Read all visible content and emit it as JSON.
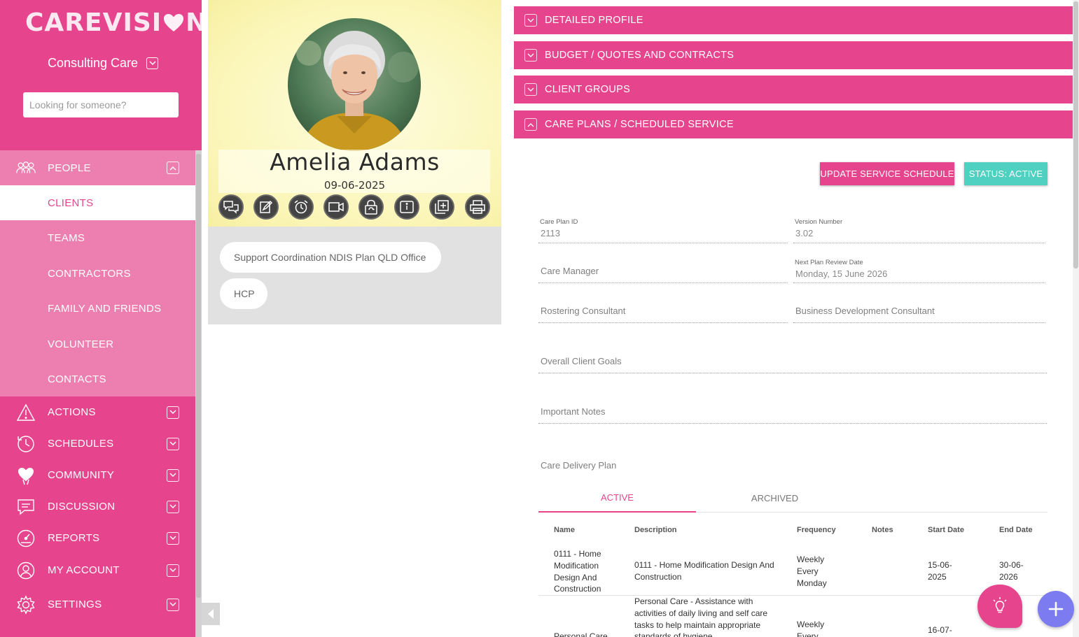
{
  "brand": {
    "logo_part1": "CAREVISI",
    "logo_part2": "N",
    "accent": "#e6458e",
    "teal": "#4fd0c0"
  },
  "sidebar": {
    "org_name": "Consulting Care",
    "search_placeholder": "Looking for someone?",
    "people": {
      "label": "PEOPLE",
      "items": [
        {
          "label": "CLIENTS",
          "active": true
        },
        {
          "label": "TEAMS"
        },
        {
          "label": "CONTRACTORS"
        },
        {
          "label": "FAMILY AND FRIENDS"
        },
        {
          "label": "VOLUNTEER"
        },
        {
          "label": "CONTACTS"
        }
      ]
    },
    "nav": [
      {
        "label": "ACTIONS",
        "icon": "warning-icon"
      },
      {
        "label": "SCHEDULES",
        "icon": "clock-cycle-icon"
      },
      {
        "label": "COMMUNITY",
        "icon": "heart-hands-icon"
      },
      {
        "label": "DISCUSSION",
        "icon": "chat-icon"
      },
      {
        "label": "REPORTS",
        "icon": "gauge-icon"
      },
      {
        "label": "MY ACCOUNT",
        "icon": "user-icon"
      },
      {
        "label": "SETTINGS",
        "icon": "gear-icon"
      }
    ]
  },
  "client": {
    "name": "Amelia Adams",
    "date": "09-06-2025",
    "actions": [
      "chat-icon",
      "edit-note-icon",
      "alarm-icon",
      "video-icon",
      "lock-refresh-icon",
      "info-icon",
      "add-document-icon",
      "print-icon"
    ],
    "tags": [
      "Support Coordination NDIS Plan QLD Office",
      "HCP"
    ]
  },
  "accordions": [
    {
      "label": "DETAILED PROFILE",
      "expanded": false
    },
    {
      "label": "BUDGET / QUOTES AND CONTRACTS",
      "expanded": false
    },
    {
      "label": "CLIENT GROUPS",
      "expanded": false
    },
    {
      "label": "CARE PLANS / SCHEDULED SERVICE",
      "expanded": true
    }
  ],
  "care_plan": {
    "update_button": "UPDATE SERVICE SCHEDULE",
    "status_button": "STATUS: ACTIVE",
    "fields": {
      "care_plan_id_label": "Care Plan ID",
      "care_plan_id": "2113",
      "version_label": "Version Number",
      "version": "3.02",
      "care_manager": "Care Manager",
      "review_date_label": "Next Plan Review Date",
      "review_date": "Monday, 15 June 2026",
      "rostering_consultant": "Rostering Consultant",
      "bd_consultant": "Business Development Consultant",
      "goals": "Overall Client Goals",
      "notes": "Important Notes"
    },
    "delivery_label": "Care Delivery Plan",
    "tabs": [
      "ACTIVE",
      "ARCHIVED"
    ],
    "table": {
      "headers": [
        "Name",
        "Description",
        "Frequency",
        "Notes",
        "Start Date",
        "End Date"
      ],
      "rows": [
        {
          "name": "0111 - Home Modification Design And Construction",
          "description": "0111 - Home Modification Design And Construction",
          "frequency": "Weekly Every Monday",
          "notes": "",
          "start": "15-06-2025",
          "end": "30-06-2026"
        },
        {
          "name": "Personal Care",
          "description": "Personal Care - Assistance with activities of daily living and self care tasks to help maintain appropriate standards of hygiene",
          "frequency": "Weekly Every",
          "notes": "",
          "start": "16-07-",
          "end": ""
        }
      ]
    }
  }
}
